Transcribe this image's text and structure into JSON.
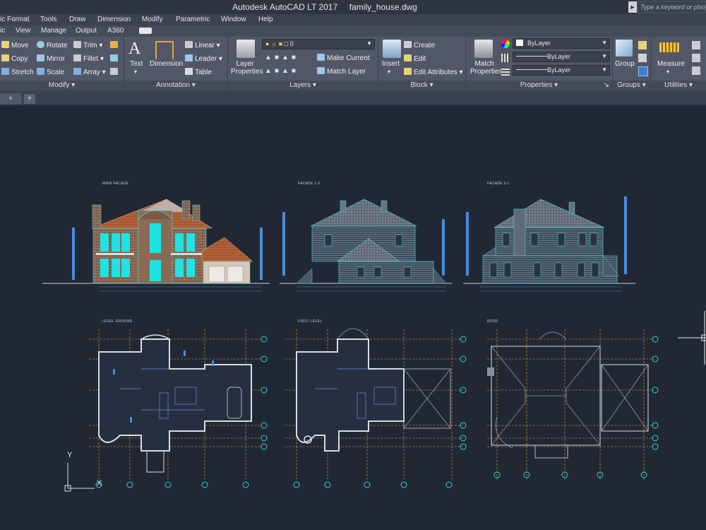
{
  "title_bar": {
    "app_title": "Autodesk AutoCAD LT 2017",
    "file_name": "family_house.dwg",
    "search_placeholder": "Type a keyword or phrase"
  },
  "menu_bar": {
    "items": [
      "ic",
      "Format",
      "Tools",
      "Draw",
      "Dimension",
      "Modify",
      "Parametric",
      "Window",
      "Help"
    ]
  },
  "ribbon_tabs": {
    "items": [
      "ic",
      "View",
      "Manage",
      "Output",
      "A360"
    ]
  },
  "ribbon": {
    "modify": {
      "title": "Modify",
      "commands": [
        "Move",
        "Rotate",
        "Trim",
        "Copy",
        "Mirror",
        "Fillet",
        "Stretch",
        "Scale",
        "Array"
      ]
    },
    "annotation": {
      "title": "Annotation",
      "text": "Text",
      "dimension": "Dimension",
      "linear": "Linear",
      "leader": "Leader",
      "table": "Table"
    },
    "layers": {
      "title": "Layers",
      "layer_properties": "Layer Properties",
      "current_layer": "0",
      "make_current": "Make Current",
      "match_layer": "Match Layer"
    },
    "block": {
      "title": "Block",
      "insert": "Insert",
      "create": "Create",
      "edit": "Edit",
      "edit_attributes": "Edit Attributes"
    },
    "properties": {
      "title": "Properties",
      "match_properties": "Match Properties",
      "color": "ByLayer",
      "linetype": "ByLayer",
      "lineweight": "ByLayer"
    },
    "groups": {
      "title": "Groups",
      "group": "Group"
    },
    "utilities": {
      "title": "Utilities",
      "measure": "Measure"
    }
  },
  "file_tabs": {
    "close_glyph": "×",
    "new_tab": "+"
  },
  "drawing": {
    "elevation_labels": [
      "MAIN FACADE",
      "FACADE 1-2",
      "FACADE 3-1"
    ],
    "plan_labels": [
      "LEVEL GROUND",
      "FIRST LEVEL",
      "ROOF"
    ],
    "ucs_y": "Y",
    "ucs_x": "X"
  }
}
